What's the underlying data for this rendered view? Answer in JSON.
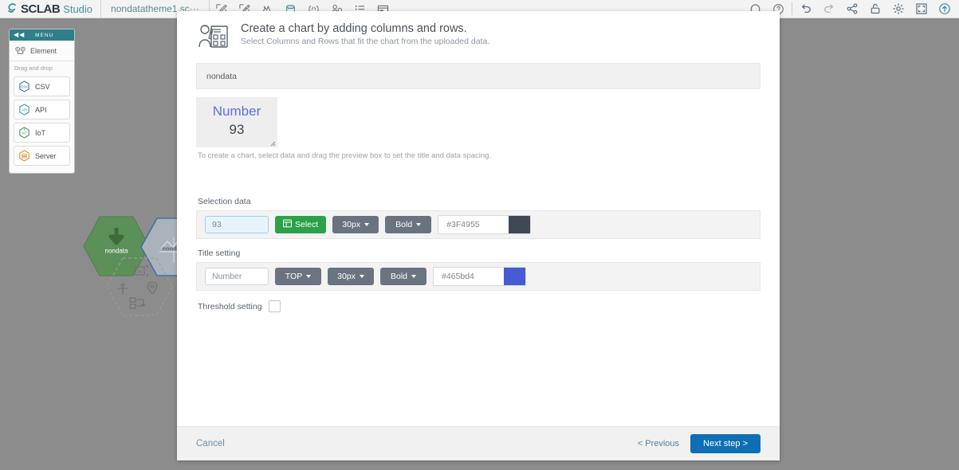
{
  "topbar": {
    "brand_mark": "S",
    "brand_name": "SCLAB",
    "brand_sub": "Studio",
    "document_tab": "nondatatheme1.sc···",
    "left_tools": [
      {
        "name": "edit-square-icon"
      },
      {
        "name": "edit-square-alt-icon"
      },
      {
        "name": "mountain-icon"
      },
      {
        "name": "database-icon"
      },
      {
        "name": "code-icon"
      },
      {
        "name": "person-search-icon"
      },
      {
        "name": "list-icon"
      },
      {
        "name": "card-icon"
      }
    ],
    "right_tools": [
      {
        "name": "arch-icon"
      },
      {
        "name": "help-icon"
      },
      {
        "name": "undo-icon"
      },
      {
        "name": "redo-icon"
      },
      {
        "name": "share-icon"
      },
      {
        "name": "unlock-icon"
      },
      {
        "name": "gear-icon"
      },
      {
        "name": "fullscreen-icon"
      },
      {
        "name": "upload-icon"
      }
    ]
  },
  "menu": {
    "collapse_glyph": "◀◀",
    "title": "MENU",
    "element_label": "Element",
    "dragdrop_label": "Drag and drop",
    "items": [
      {
        "label": "CSV",
        "icon": "csv-hex-icon",
        "color": "#2f6fa8"
      },
      {
        "label": "API",
        "icon": "api-hex-icon",
        "color": "#2f8fa8"
      },
      {
        "label": "IoT",
        "icon": "iot-hex-icon",
        "color": "#3f8f4f"
      },
      {
        "label": "Server",
        "icon": "server-hex-icon",
        "color": "#d08b28"
      }
    ]
  },
  "canvas": {
    "nodes": [
      {
        "name": "node-source-nondata",
        "label": "nondata",
        "kind": "source"
      },
      {
        "name": "node-chart-nondata",
        "label": "nondata",
        "kind": "chart"
      },
      {
        "name": "node-tools-placeholder",
        "label": "",
        "kind": "tools"
      }
    ]
  },
  "modal": {
    "header": {
      "icon": "chart-designer-icon",
      "title": "Create a chart by adding columns and rows.",
      "subtitle": "Select Columns and Rows that fit the chart from the uploaded data."
    },
    "dataset_name": "nondata",
    "preview": {
      "title_text": "Number",
      "value_text": "93",
      "resize_handle": "◢"
    },
    "hint": "To create a chart, select data and drag the preview box to set the title and data spacing.",
    "selection": {
      "section_label": "Selection data",
      "value": "93",
      "value_placeholder": "93",
      "select_button": "Select",
      "select_icon": "table-grid-icon",
      "font_size": "30px",
      "font_weight": "Bold",
      "color_hex": "#3F4955",
      "color_swatch": "#3F4955"
    },
    "title_setting": {
      "section_label": "Title setting",
      "value": "Number",
      "position": "TOP",
      "font_size": "30px",
      "font_weight": "Bold",
      "color_hex": "#465bd4",
      "color_swatch": "#465bd4"
    },
    "threshold": {
      "label": "Threshold setting",
      "checked": false
    },
    "footer": {
      "cancel": "Cancel",
      "previous": "< Previous",
      "next": "Next step >"
    }
  },
  "colors": {
    "accent_green": "#2ba14a",
    "accent_blue": "#0f6fb5",
    "teal": "#2f7f88",
    "node_green": "#5b9158"
  }
}
